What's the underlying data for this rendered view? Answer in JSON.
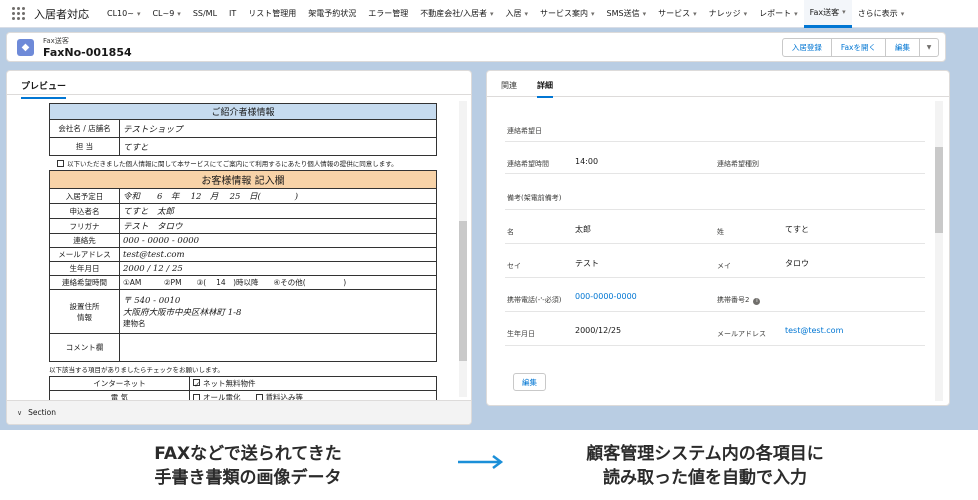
{
  "nav": {
    "app_name": "入居者対応",
    "items": [
      "CL10~",
      "CL~9",
      "SS/ML",
      "IT",
      "リスト管理用",
      "架電予約状況",
      "エラー管理",
      "不動産会社/入居者",
      "入居",
      "サービス案内",
      "SMS送信",
      "サービス",
      "ナレッジ",
      "レポート",
      "Fax送客",
      "さらに表示"
    ],
    "active_item": "Fax送客"
  },
  "header": {
    "object_type": "Fax送客",
    "record_name": "FaxNo-001854",
    "buttons": [
      "入居登録",
      "Faxを開く",
      "編集"
    ]
  },
  "left_panel": {
    "tab": "プレビュー",
    "section_label": "Section"
  },
  "fax": {
    "intro_title": "ご紹介者様情報",
    "company_label": "会社名 / 店舗名",
    "company_value": "テストショップ",
    "staff_label": "担 当",
    "staff_value": "てすと",
    "consent_text": "以下いただきました個人情報に関して本サービスにてご案内にて利用するにあたり個人情報の提供に同意します。",
    "customer_title": "お客様情報 記入欄",
    "rows": [
      {
        "label": "入居予定日",
        "value": "令和　　6　年　 12　月　 25　日(　　　　)"
      },
      {
        "label": "申込者名",
        "value": "てすと　太郎"
      },
      {
        "label": "フリガナ",
        "value": "テスト　タロウ"
      },
      {
        "label": "連絡先",
        "value": "000 - 0000 - 0000"
      },
      {
        "label": "メールアドレス",
        "value": "test@test.com"
      },
      {
        "label": "生年月日",
        "value": "2000 / 12 / 25"
      },
      {
        "label": "連絡希望時間",
        "value": "①AM　　　②PM　　③(　 14　)時以降　　④その他(　　　　　)"
      }
    ],
    "address_label": "設置住所\n情報",
    "address_lines": [
      "〒 540 - 0010",
      "大阪府大阪市中央区林林町 1-8",
      "建物名"
    ],
    "comment_label": "コメント欄",
    "checklist_note": "以下該当する項目がありましたらチェックをお願いします。",
    "checklist": [
      {
        "label": "インターネット",
        "options": [
          "ネット無料物件"
        ]
      },
      {
        "label": "電 気",
        "options": [
          "オール電化",
          "賃料込み等"
        ]
      }
    ]
  },
  "right_panel": {
    "tabs": [
      "関連",
      "詳細"
    ],
    "active_tab": "詳細",
    "fields": [
      {
        "label": "連絡希望日",
        "value": ""
      },
      {
        "label": "連絡希望時間",
        "value": "14:00"
      },
      {
        "label": "連絡希望種別",
        "value": ""
      },
      {
        "label": "備考(架電前備考)",
        "value": ""
      },
      {
        "label": "名",
        "value": "太郎"
      },
      {
        "label": "姓",
        "value": "てすと"
      },
      {
        "label": "セイ",
        "value": "テスト"
      },
      {
        "label": "メイ",
        "value": "タロウ"
      },
      {
        "label": "携帯電話(-'-必須)",
        "value": "000-0000-0000"
      },
      {
        "label": "携帯番号2",
        "value": ""
      },
      {
        "label": "生年月日",
        "value": "2000/12/25"
      },
      {
        "label": "メールアドレス",
        "value": "test@test.com"
      }
    ],
    "edit_button": "編集"
  },
  "captions": {
    "left_line1": "FAXなどで送られてきた",
    "left_line2": "手書き書類の画像データ",
    "right_line1": "顧客管理システム内の各項目に",
    "right_line2": "読み取った値を自動で入力"
  },
  "colors": {
    "accent": "#0176d3",
    "arrow": "#1b8fd8",
    "background": "#b9cde3"
  }
}
